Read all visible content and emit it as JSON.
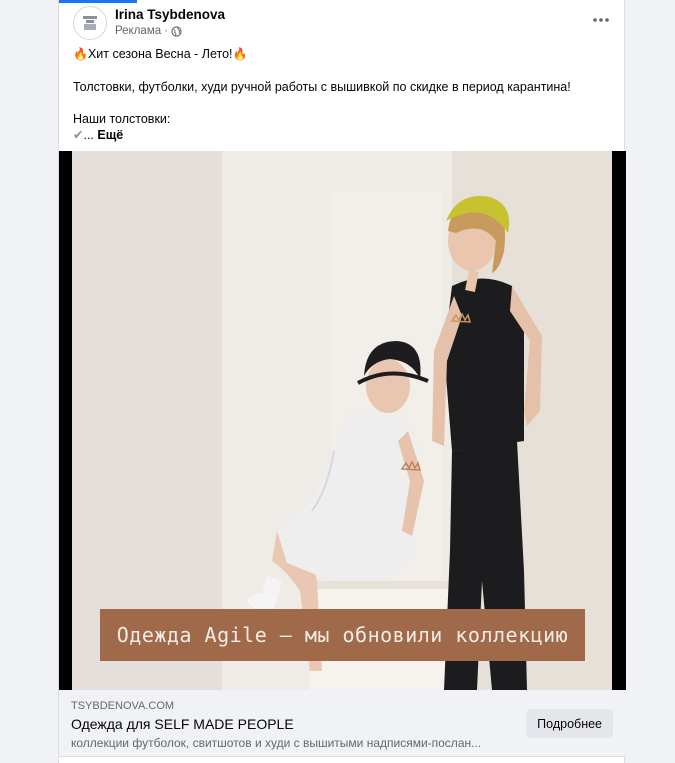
{
  "post": {
    "page_name": "Irina Tsybdenova",
    "sponsored_label": "Реклама",
    "separator": "·",
    "audience_icon": "globe-icon",
    "menu_icon": "more-horizontal-icon",
    "line1": "Хит сезона Весна - Лето!",
    "line1_icon": "fire-icon",
    "line2": "Толстовки, футболки, худи ручной работы с вышивкой по скидке в период карантина!",
    "line3": "Наши толстовки:",
    "check_icon": "checkmark-icon",
    "ellipsis": "... ",
    "see_more": "Ещё"
  },
  "media": {
    "banner_text": "Одежда Agile — мы обновили коллекцию"
  },
  "link": {
    "domain": "TSYBDENOVA.COM",
    "title": "Одежда для SELF MADE PEOPLE",
    "description": "коллекции футболок, свитшотов и худи с вышитыми надписями-послан...",
    "cta_label": "Подробнее"
  },
  "colors": {
    "accent": "#1877f2",
    "banner": "#a0694a",
    "card": "#ffffff",
    "page_bg": "#f0f2f5"
  }
}
